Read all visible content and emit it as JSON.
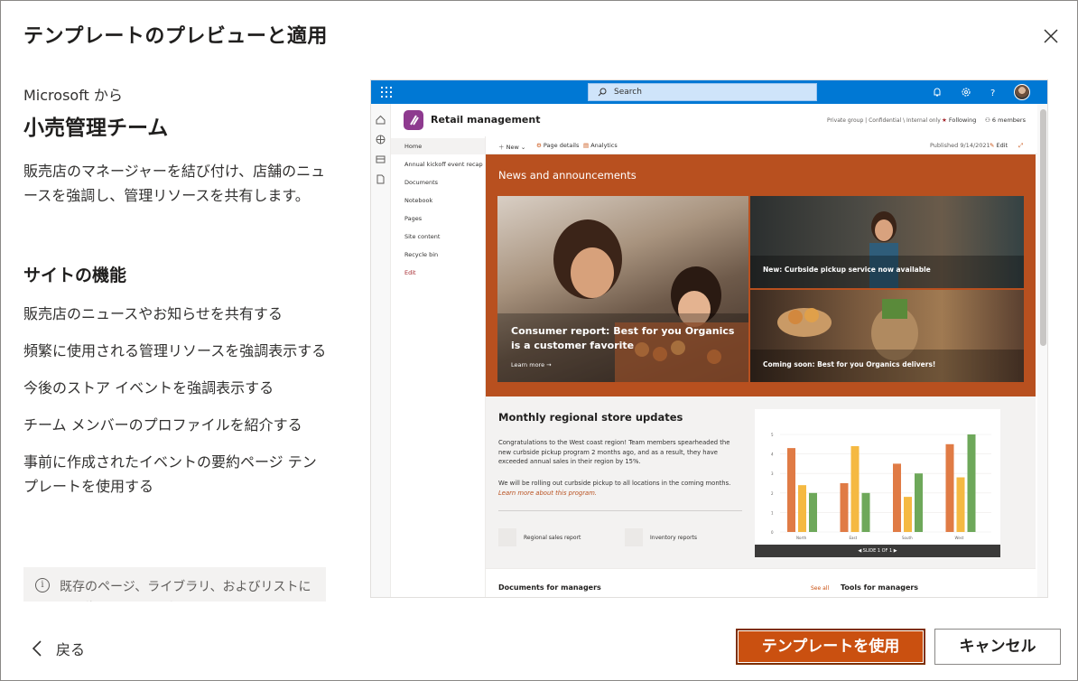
{
  "dialog": {
    "title": "テンプレートのプレビューと適用",
    "close_icon": "close-icon"
  },
  "template": {
    "from": "Microsoft から",
    "name": "小売管理チーム",
    "description": "販売店のマネージャーを結び付け、店舗のニュースを強調し、管理リソースを共有します。",
    "features_heading": "サイトの機能",
    "features": [
      "販売店のニュースやお知らせを共有する",
      "頻繁に使用される管理リソースを強調表示する",
      "今後のストア イベントを強調表示する",
      "チーム メンバーのプロファイルを紹介する",
      "事前に作成されたイベントの要約ページ テンプレートを使用する"
    ],
    "info": "既存のページ、ライブラリ、およびリストには影響ありませんがテンプレー"
  },
  "preview": {
    "search_placeholder": "Search",
    "site_name": "Retail management",
    "site_meta": "Private group | Confidential \\ Internal only",
    "following": "Following",
    "members": "6 members",
    "nav": [
      "Home",
      "Annual kickoff event recap",
      "Documents",
      "Notebook",
      "Pages",
      "Site content",
      "Recycle bin",
      "Edit"
    ],
    "cmd_new": "New",
    "cmd_page_details": "Page details",
    "cmd_analytics": "Analytics",
    "published": "Published 9/14/2021",
    "cmd_edit": "Edit",
    "news_heading": "News and announcements",
    "news_main": "Consumer report: Best for you Organics is a customer favorite",
    "learn_more": "Learn more →",
    "news_tile_1": "New: Curbside pickup service now available",
    "news_tile_2": "Coming soon: Best for you Organics delivers!",
    "monthly_heading": "Monthly regional store updates",
    "monthly_p1": "Congratulations to the West coast region! Team members spearheaded the new curbside pickup program 2 months ago, and as a result, they have exceeded annual sales in their region by 15%.",
    "monthly_p2": "We will be rolling out curbside pickup to all locations in the coming months.",
    "monthly_link": "Learn more about this program.",
    "quick_1": "Regional sales report",
    "quick_2": "Inventory reports",
    "slide_label": "SLIDE 1 OF 1",
    "docs_heading": "Documents for managers",
    "see_all": "See all",
    "tools_heading": "Tools for managers",
    "chart_regions": [
      "North",
      "East",
      "South",
      "West"
    ],
    "chart_ticks": [
      "5",
      "4",
      "3",
      "2",
      "1",
      "0"
    ],
    "chart_values": [
      [
        4.3,
        2.4,
        2.0
      ],
      [
        2.5,
        4.4,
        2.0
      ],
      [
        3.5,
        1.8,
        3.0
      ],
      [
        4.5,
        2.8,
        5.0
      ]
    ],
    "chart_colors": [
      "#e07b45",
      "#f5b942",
      "#6ea85a"
    ]
  },
  "footer": {
    "back": "戻る",
    "use_template": "テンプレートを使用",
    "cancel": "キャンセル"
  },
  "colors": {
    "accent": "#ca5010",
    "news_bg": "#b8501f",
    "suite_bar": "#0078d4"
  }
}
